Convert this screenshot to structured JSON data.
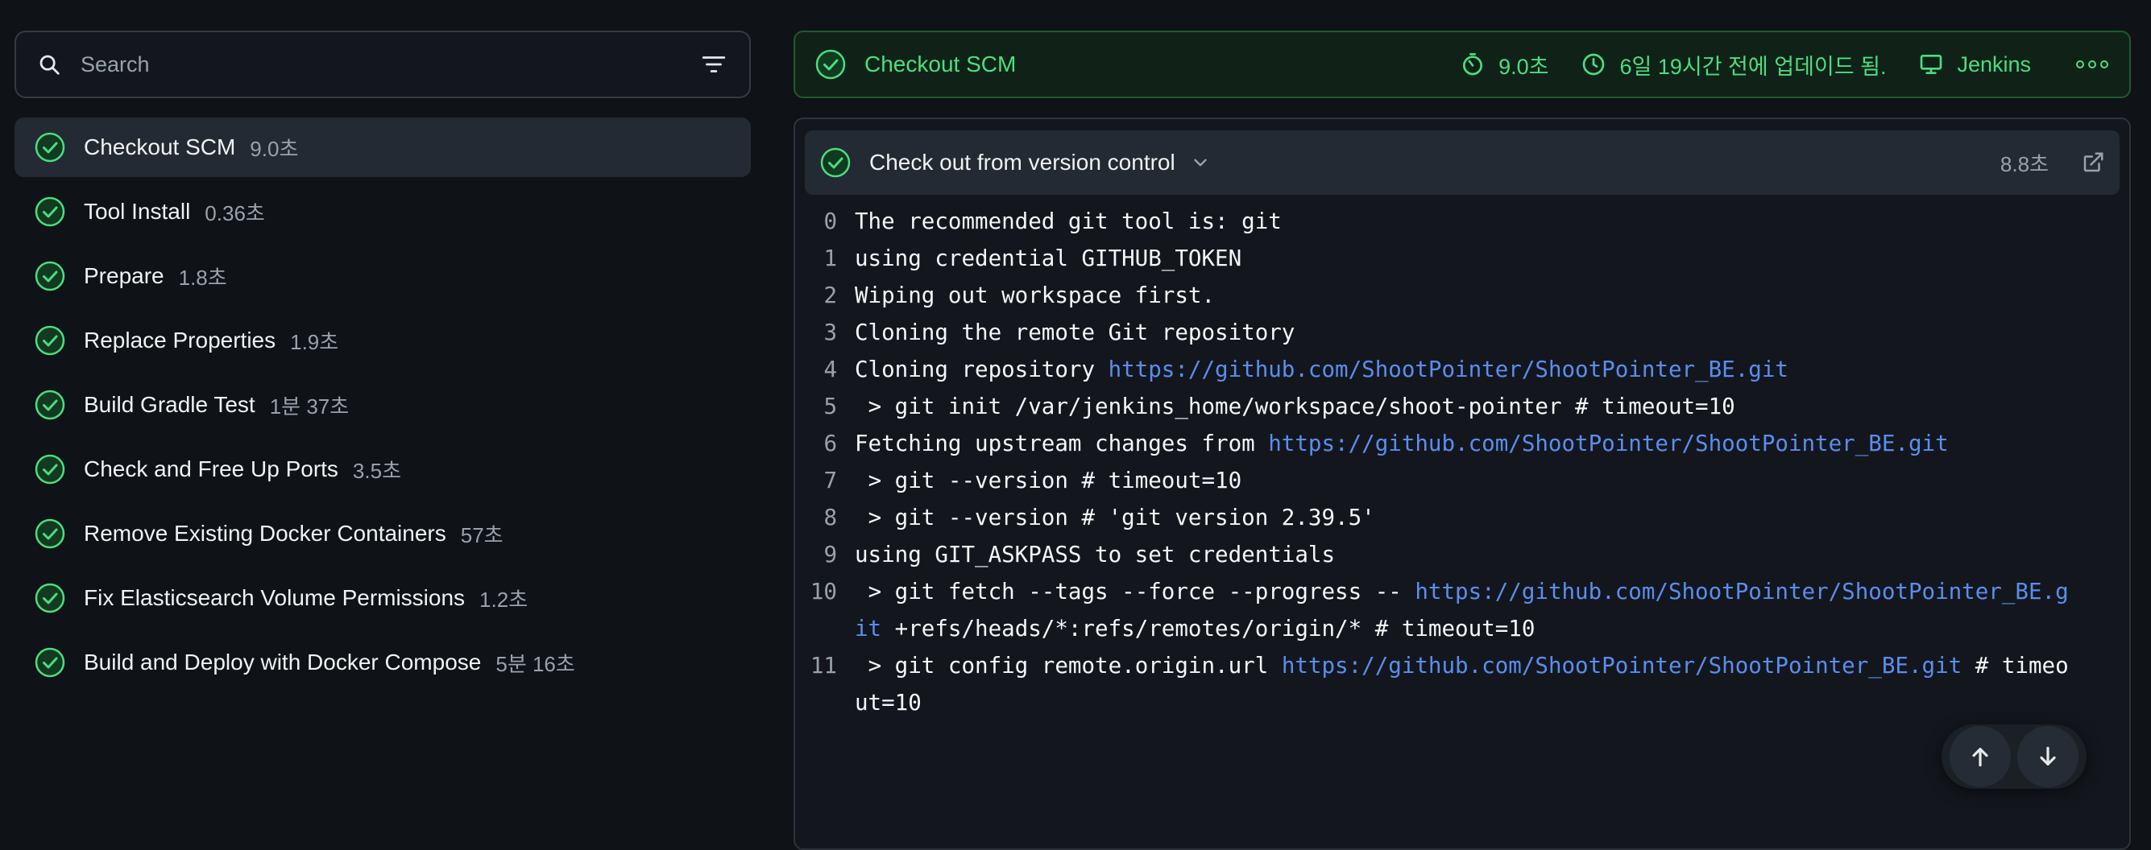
{
  "search": {
    "placeholder": "Search"
  },
  "stages": [
    {
      "name": "Checkout SCM",
      "duration": "9.0초",
      "active": true
    },
    {
      "name": "Tool Install",
      "duration": "0.36초"
    },
    {
      "name": "Prepare",
      "duration": "1.8초"
    },
    {
      "name": "Replace Properties",
      "duration": "1.9초"
    },
    {
      "name": "Build Gradle Test",
      "duration": "1분 37초"
    },
    {
      "name": "Check and Free Up Ports",
      "duration": "3.5초"
    },
    {
      "name": "Remove Existing Docker Containers",
      "duration": "57초"
    },
    {
      "name": "Fix Elasticsearch Volume Permissions",
      "duration": "1.2초"
    },
    {
      "name": "Build and Deploy with Docker Compose",
      "duration": "5분 16초"
    }
  ],
  "header": {
    "title": "Checkout SCM",
    "duration": "9.0초",
    "updated": "6일 19시간 전에 업데이드 됨.",
    "agent": "Jenkins"
  },
  "step": {
    "title": "Check out from version control",
    "duration": "8.8초"
  },
  "log": [
    {
      "n": "0",
      "parts": [
        {
          "t": "The recommended git tool is: git"
        }
      ]
    },
    {
      "n": "1",
      "parts": [
        {
          "t": "using credential GITHUB_TOKEN"
        }
      ]
    },
    {
      "n": "2",
      "parts": [
        {
          "t": "Wiping out workspace first."
        }
      ]
    },
    {
      "n": "3",
      "parts": [
        {
          "t": "Cloning the remote Git repository"
        }
      ]
    },
    {
      "n": "4",
      "parts": [
        {
          "t": "Cloning repository "
        },
        {
          "t": "https://github.com/ShootPointer/ShootPointer_BE.git",
          "link": true
        }
      ]
    },
    {
      "n": "5",
      "parts": [
        {
          "t": " > git init /var/jenkins_home/workspace/shoot-pointer # timeout=10"
        }
      ]
    },
    {
      "n": "6",
      "parts": [
        {
          "t": "Fetching upstream changes from "
        },
        {
          "t": "https://github.com/ShootPointer/ShootPointer_BE.git",
          "link": true
        }
      ]
    },
    {
      "n": "7",
      "parts": [
        {
          "t": " > git --version # timeout=10"
        }
      ]
    },
    {
      "n": "8",
      "parts": [
        {
          "t": " > git --version # 'git version 2.39.5'"
        }
      ]
    },
    {
      "n": "9",
      "parts": [
        {
          "t": "using GIT_ASKPASS to set credentials"
        }
      ]
    },
    {
      "n": "10",
      "parts": [
        {
          "t": " > git fetch --tags --force --progress -- "
        },
        {
          "t": "https://github.com/ShootPointer/ShootPointer_BE.git",
          "link": true
        },
        {
          "t": " +refs/heads/*:refs/remotes/origin/* # timeout=10"
        }
      ]
    },
    {
      "n": "11",
      "parts": [
        {
          "t": " > git config remote.origin.url "
        },
        {
          "t": "https://github.com/ShootPointer/ShootPointer_BE.git",
          "link": true
        },
        {
          "t": " # timeout=10"
        }
      ]
    }
  ],
  "colors": {
    "success": "#4ade80",
    "link": "#5b8def",
    "bg": "#0f1217"
  },
  "icons": {
    "search": "search-icon",
    "filter": "filter-icon",
    "check": "check-circle-icon",
    "timer": "timer-icon",
    "clock": "clock-icon",
    "agent": "monitor-icon",
    "more": "more-icon",
    "chevron": "chevron-down-icon",
    "external": "external-link-icon",
    "up": "arrow-up-icon",
    "down": "arrow-down-icon"
  }
}
